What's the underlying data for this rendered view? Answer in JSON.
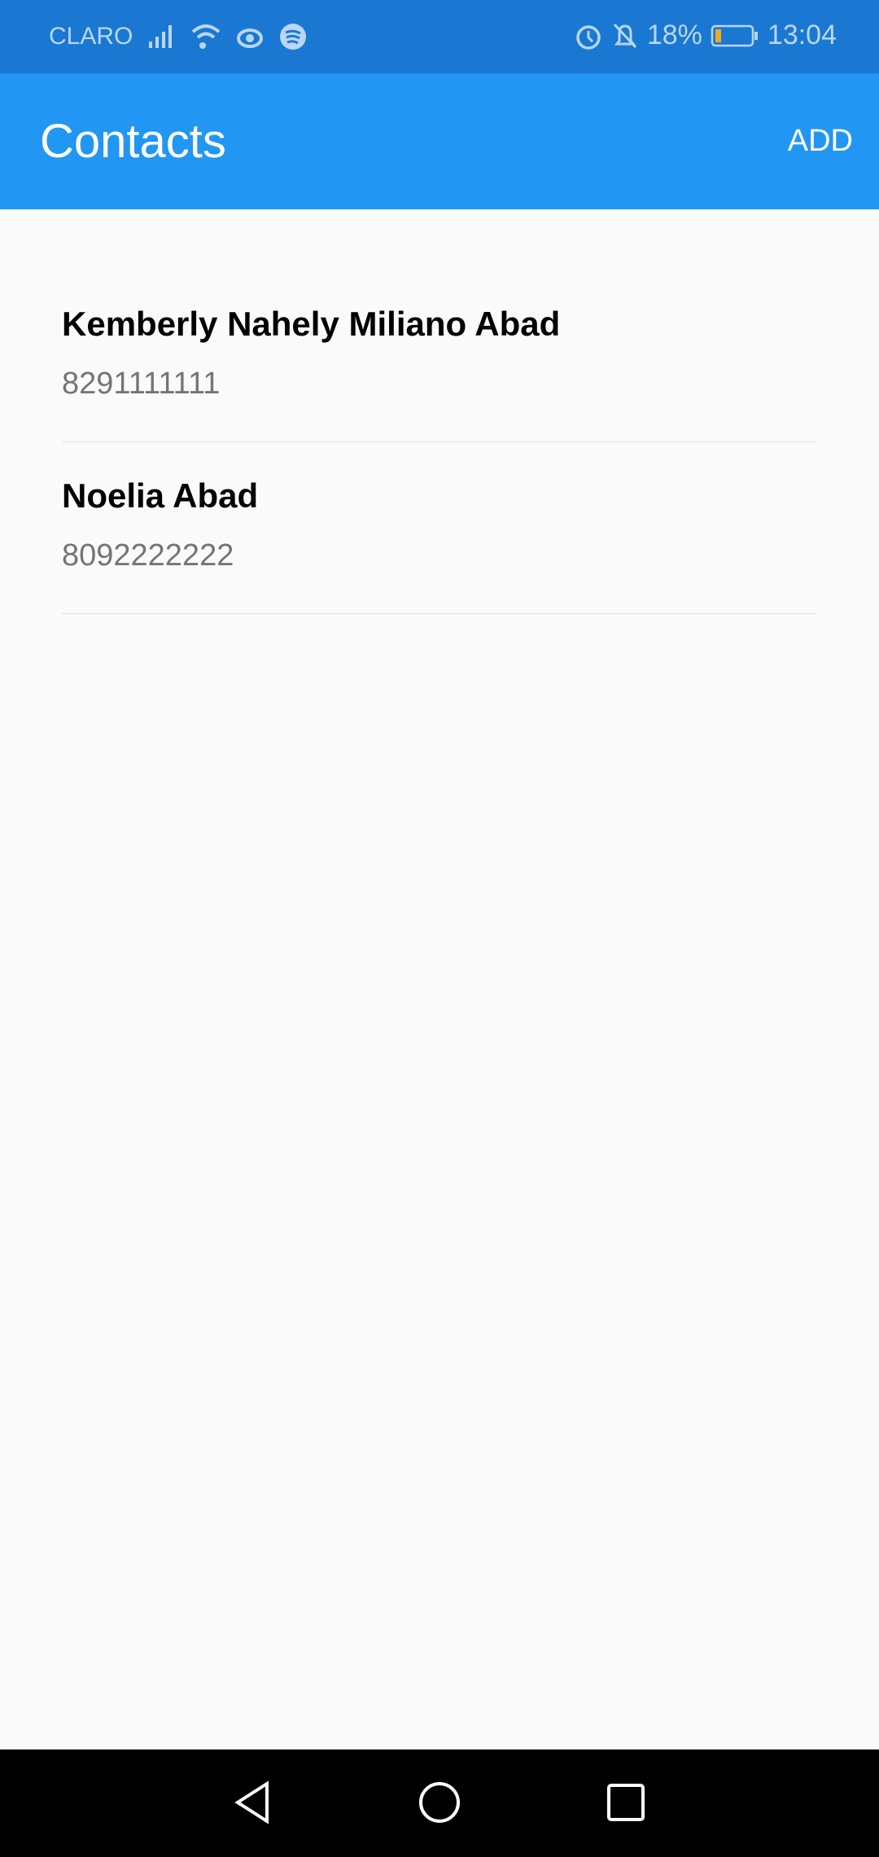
{
  "status_bar": {
    "carrier": "CLARO",
    "battery": "18%",
    "time": "13:04"
  },
  "app_bar": {
    "title": "Contacts",
    "add_label": "ADD"
  },
  "contacts": [
    {
      "name": "Kemberly Nahely Miliano Abad",
      "phone": "8291111111"
    },
    {
      "name": "Noelia Abad",
      "phone": "8092222222"
    }
  ]
}
